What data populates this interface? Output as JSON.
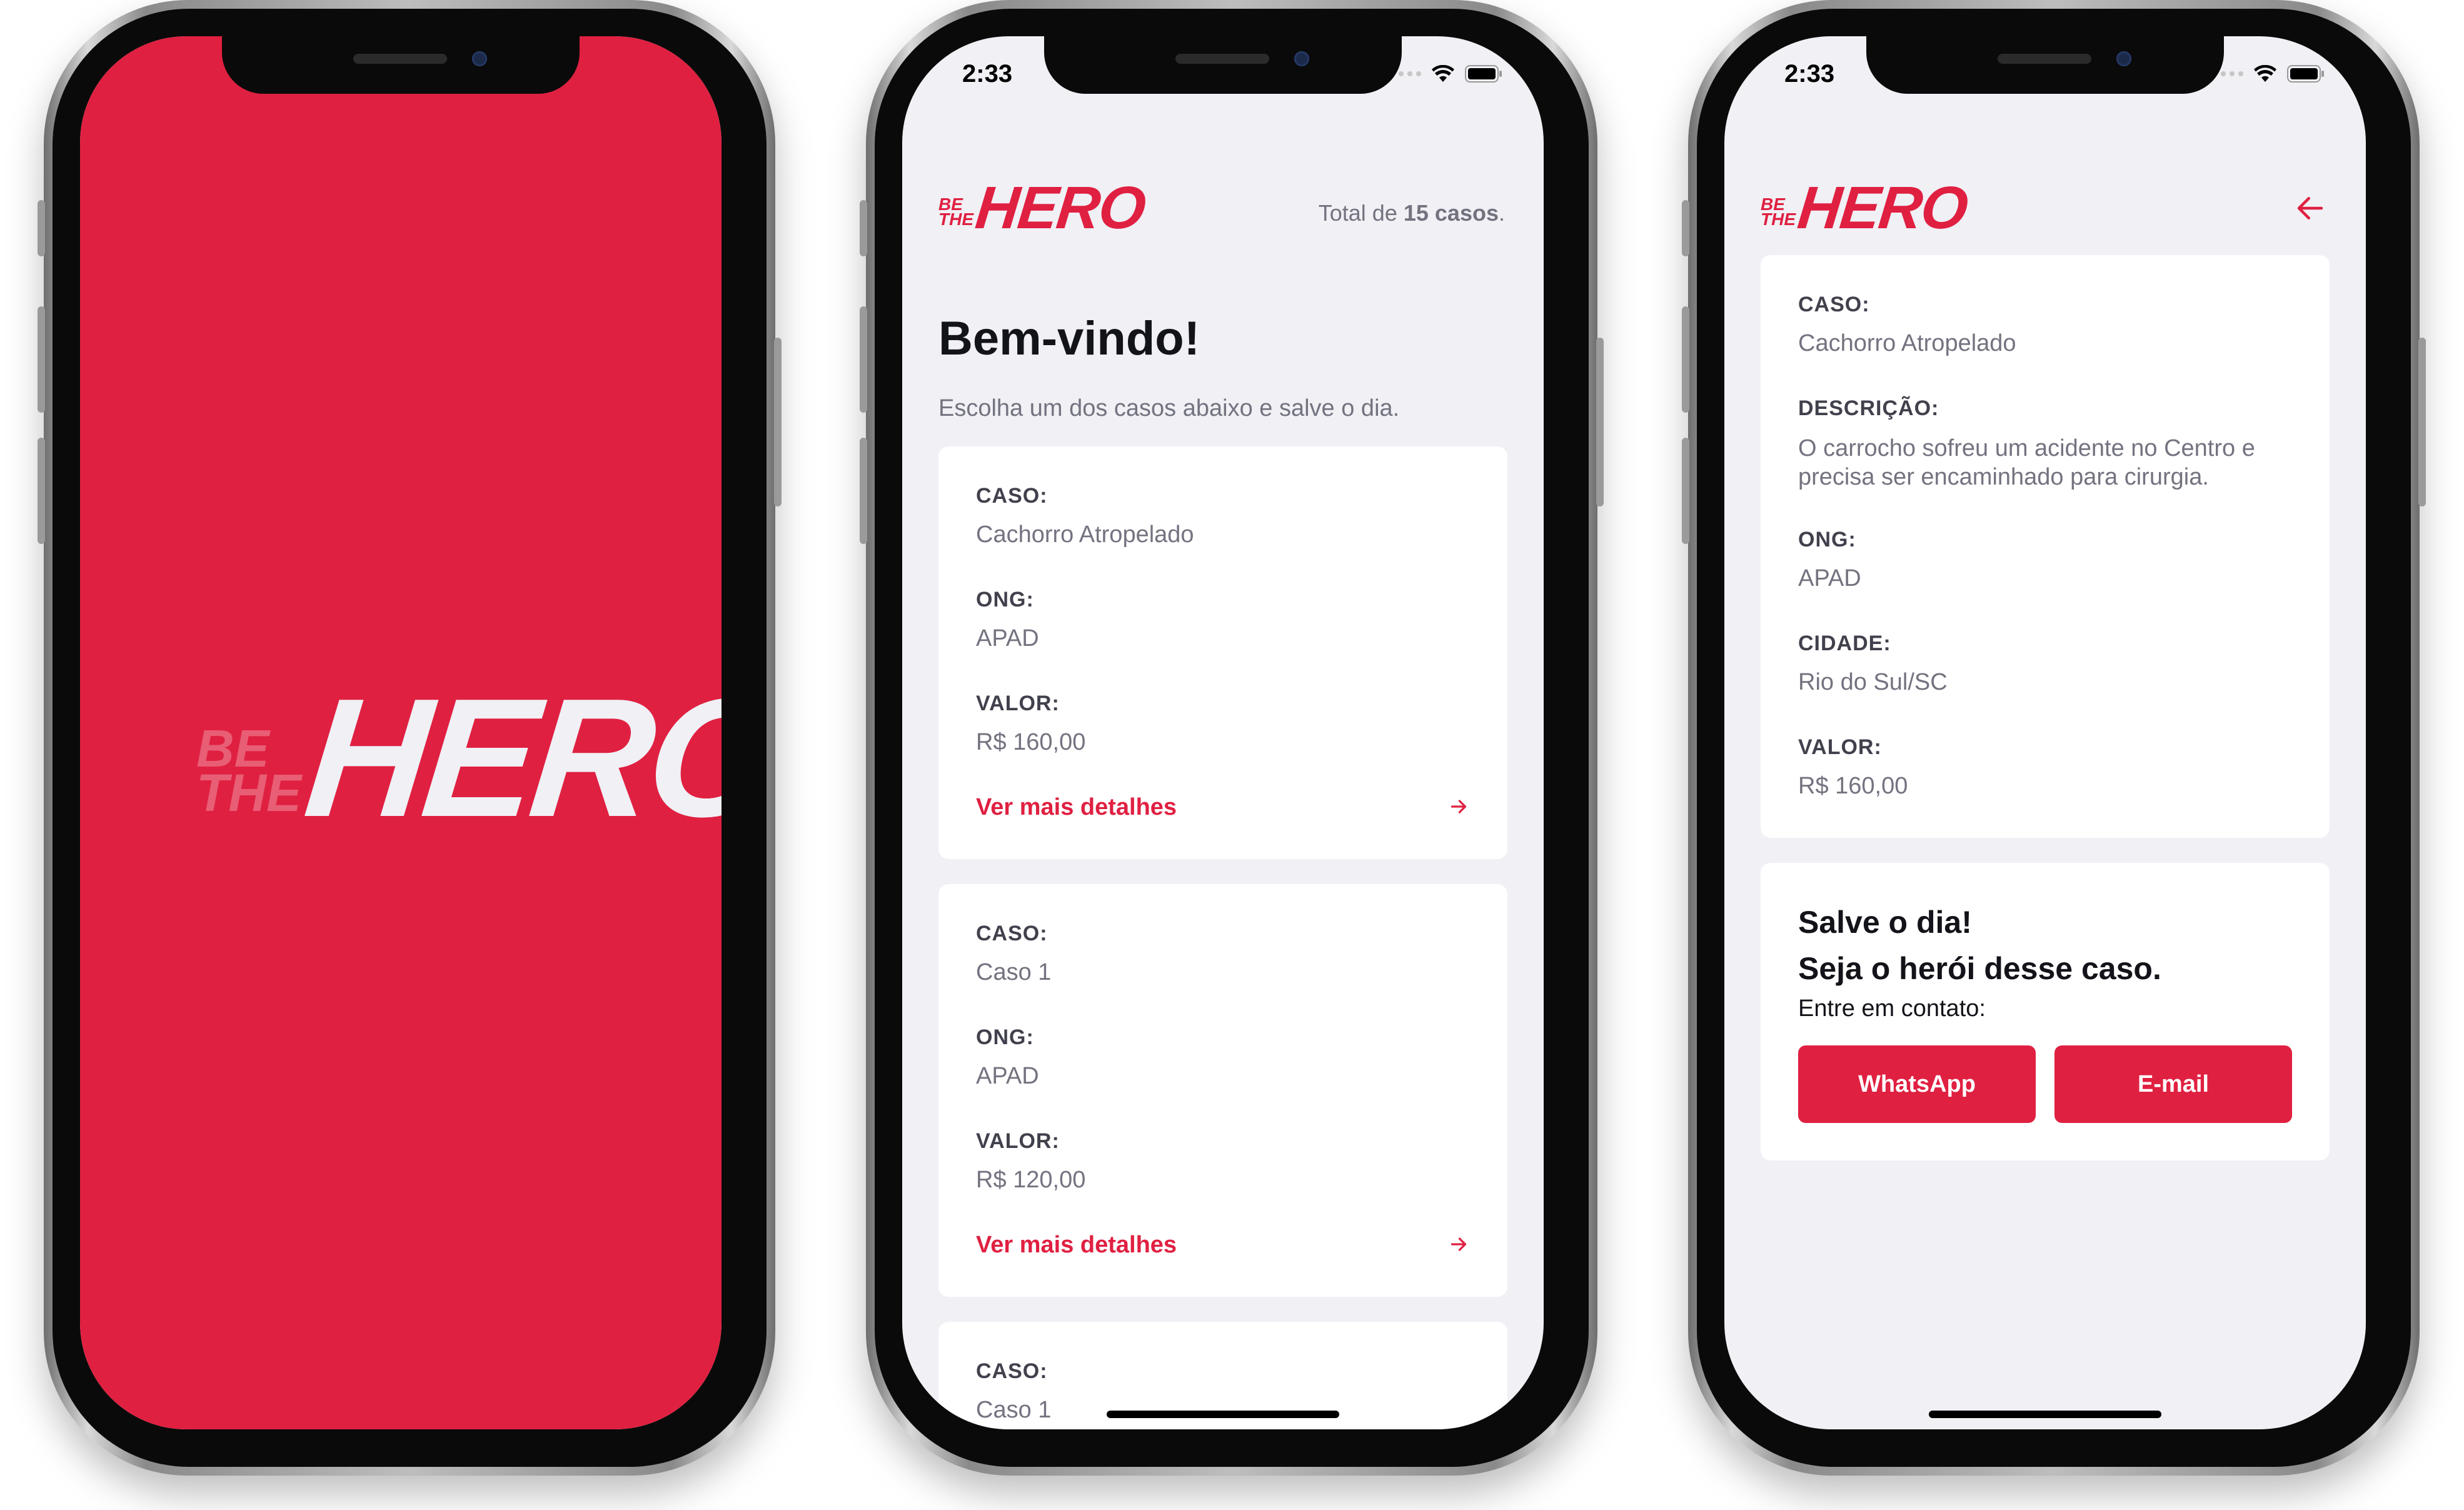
{
  "colors": {
    "brand_red": "#e02041",
    "background": "#f0f0f5",
    "card": "#ffffff",
    "text_dark": "#13131a",
    "text_muted": "#737380"
  },
  "status_bar": {
    "time": "2:33"
  },
  "logo": {
    "line1": "BE",
    "line2": "THE",
    "main": "HERO"
  },
  "splash": {},
  "list_screen": {
    "total_prefix": "Total de ",
    "total_count": "15 casos",
    "total_suffix": ".",
    "title": "Bem-vindo!",
    "subtitle": "Escolha um dos casos abaixo e salve o dia.",
    "labels": {
      "caso": "CASO:",
      "ong": "ONG:",
      "valor": "VALOR:",
      "details": "Ver mais detalhes"
    },
    "incidents": [
      {
        "caso": "Cachorro Atropelado",
        "ong": "APAD",
        "valor": "R$ 160,00"
      },
      {
        "caso": "Caso 1",
        "ong": "APAD",
        "valor": "R$ 120,00"
      },
      {
        "caso": "Caso 1"
      }
    ]
  },
  "detail_screen": {
    "labels": {
      "caso": "CASO:",
      "descricao": "DESCRIÇÃO:",
      "ong": "ONG:",
      "cidade": "CIDADE:",
      "valor": "VALOR:"
    },
    "incident": {
      "caso": "Cachorro Atropelado",
      "descricao": "O carrocho sofreu um acidente no Centro e precisa ser encaminhado para cirurgia.",
      "ong": "APAD",
      "cidade": "Rio do Sul/SC",
      "valor": "R$ 160,00"
    },
    "contact": {
      "title1": "Salve o dia!",
      "title2": "Seja o herói desse caso.",
      "subtitle": "Entre em contato:",
      "whatsapp": "WhatsApp",
      "email": "E-mail"
    }
  }
}
